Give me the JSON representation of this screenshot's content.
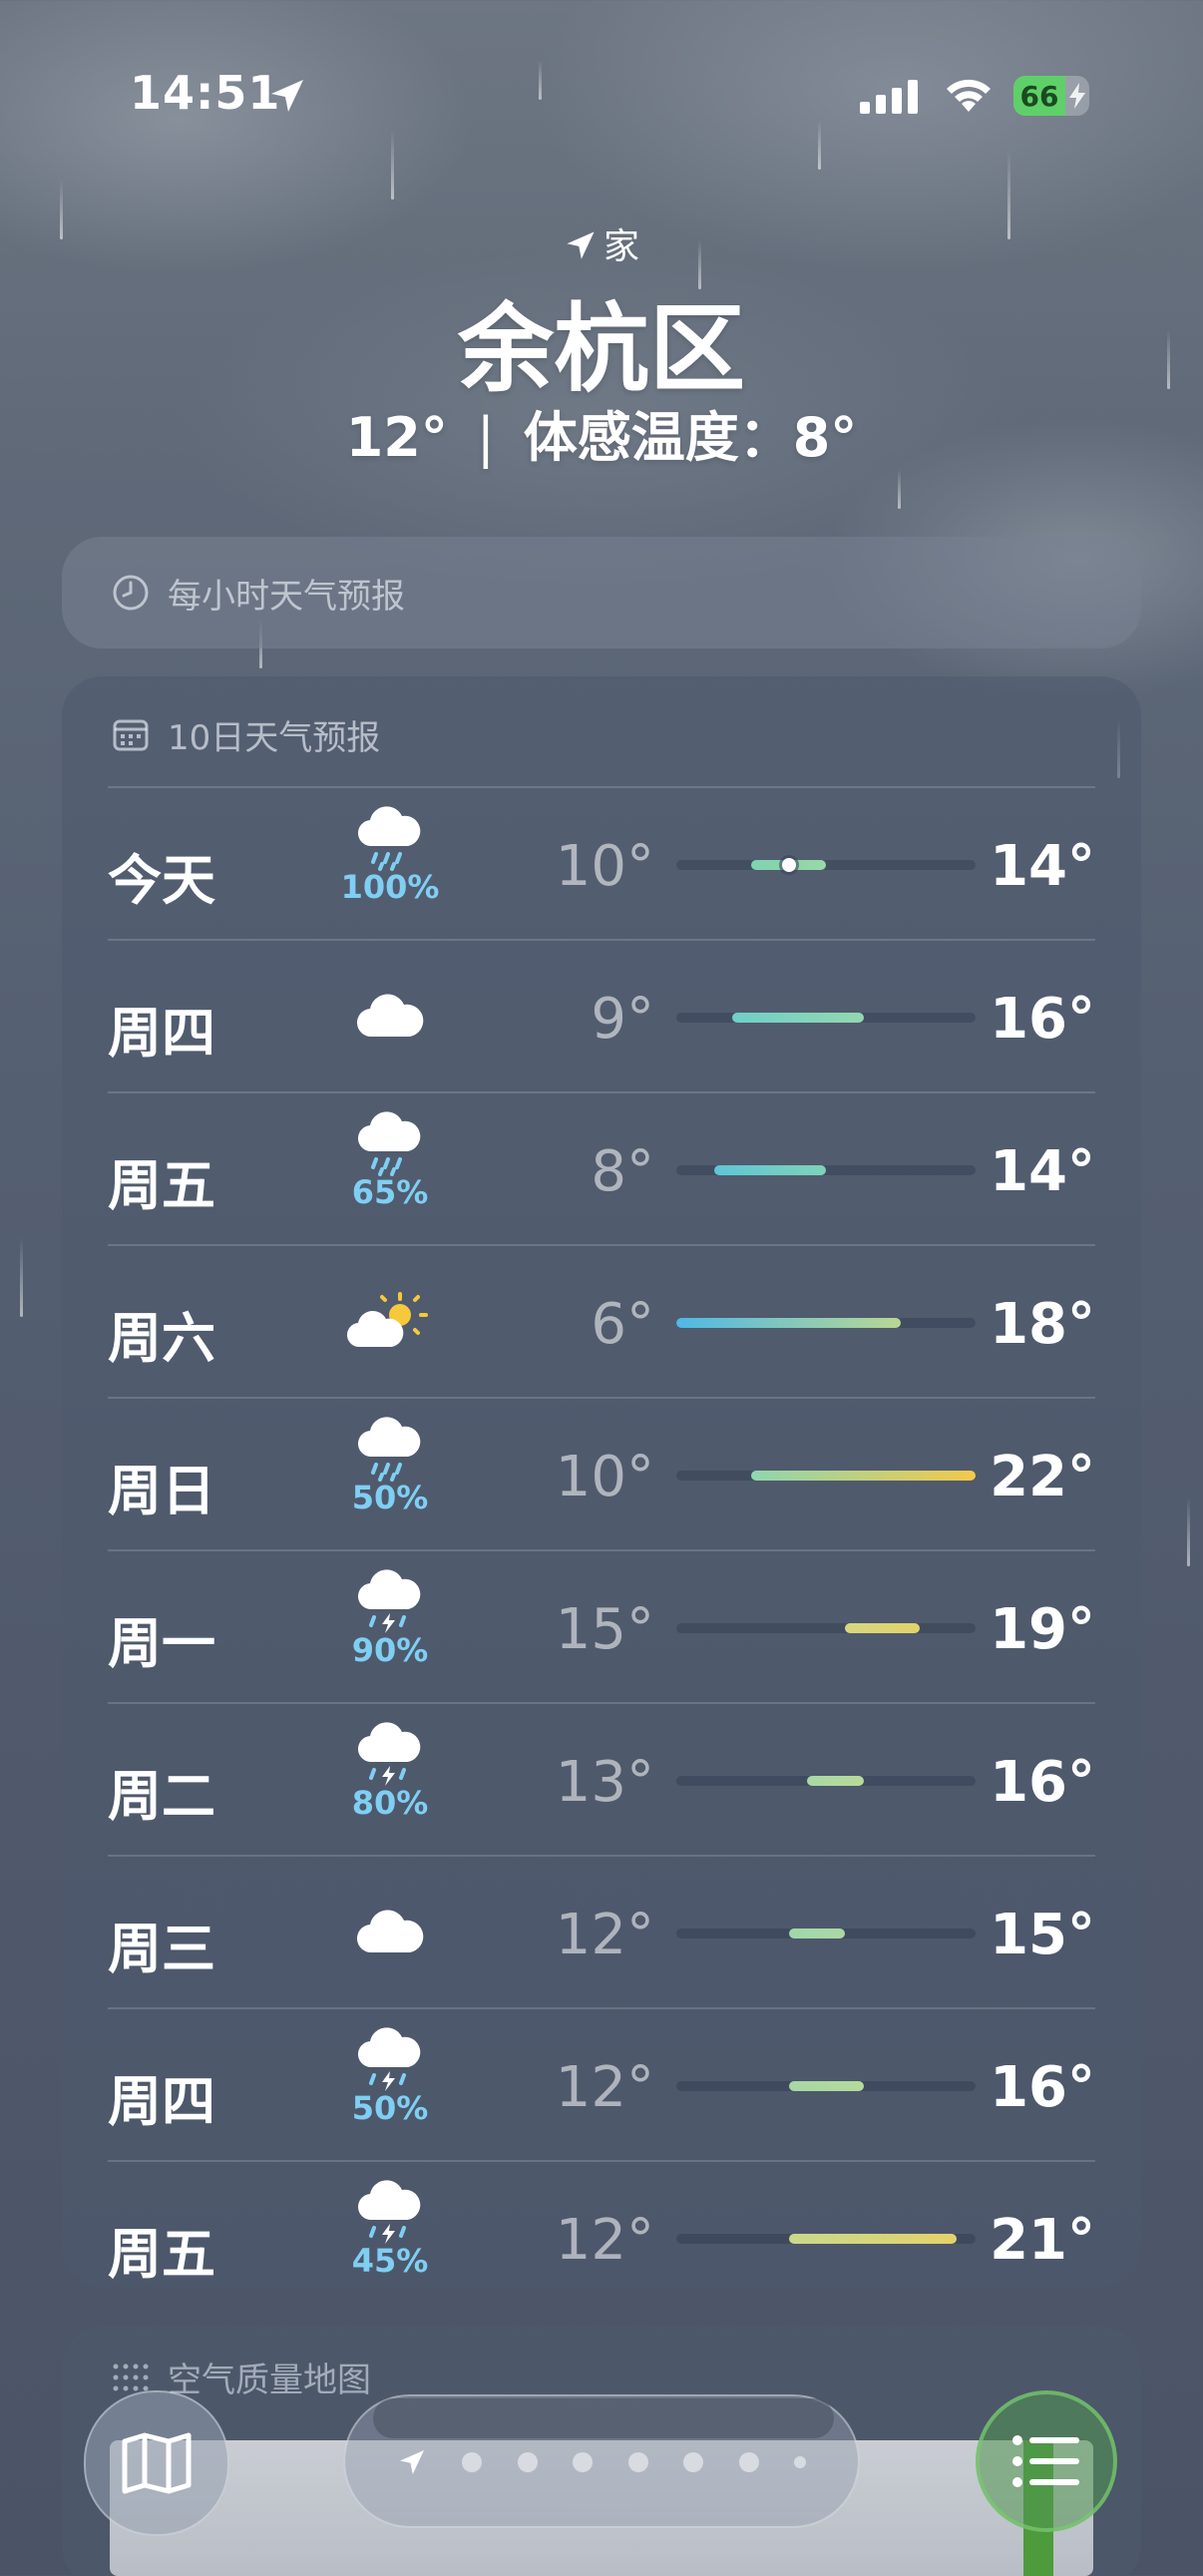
{
  "status_bar": {
    "time": "14:51",
    "battery": "66",
    "location_services_icon": "location-arrow-icon",
    "signal_icon": "cellular-signal-icon",
    "wifi_icon": "wifi-icon"
  },
  "header": {
    "location_label": "家",
    "city": "余杭区",
    "current_temp": "12°",
    "separator": "|",
    "feels_like": "体感温度：8°"
  },
  "hourly_card": {
    "title": "每小时天气预报",
    "icon": "clock-icon"
  },
  "daily_card": {
    "title": "10日天气预报",
    "icon": "calendar-icon",
    "range": [
      6,
      22
    ],
    "days": [
      {
        "day": "今天",
        "icon": "rain-icon",
        "precip": "100%",
        "low": "10°",
        "high": "14°",
        "lo": 10,
        "hi": 14,
        "current": 12,
        "colors": [
          "#7ed2b0",
          "#9ad8a8"
        ]
      },
      {
        "day": "周四",
        "icon": "cloud-icon",
        "precip": "",
        "low": "9°",
        "high": "16°",
        "lo": 9,
        "hi": 16,
        "colors": [
          "#6fcfc8",
          "#93d7b0"
        ]
      },
      {
        "day": "周五",
        "icon": "rain-icon",
        "precip": "65%",
        "low": "8°",
        "high": "14°",
        "lo": 8,
        "hi": 14,
        "colors": [
          "#5fc6d6",
          "#7ed2b8"
        ]
      },
      {
        "day": "周六",
        "icon": "partly-sunny-icon",
        "precip": "",
        "low": "6°",
        "high": "18°",
        "lo": 6,
        "hi": 18,
        "colors": [
          "#4eb8e6",
          "#b8d892"
        ]
      },
      {
        "day": "周日",
        "icon": "rain-icon",
        "precip": "50%",
        "low": "10°",
        "high": "22°",
        "lo": 10,
        "hi": 22,
        "colors": [
          "#8fd6b0",
          "#f2c94c"
        ]
      },
      {
        "day": "周一",
        "icon": "thunderstorm-icon",
        "precip": "90%",
        "low": "15°",
        "high": "19°",
        "lo": 15,
        "hi": 19,
        "colors": [
          "#d8d780",
          "#e2d26a"
        ]
      },
      {
        "day": "周二",
        "icon": "thunderstorm-icon",
        "precip": "80%",
        "low": "13°",
        "high": "16°",
        "lo": 13,
        "hi": 16,
        "colors": [
          "#a8d9a6",
          "#b7da98"
        ]
      },
      {
        "day": "周三",
        "icon": "cloud-icon",
        "precip": "",
        "low": "12°",
        "high": "15°",
        "lo": 12,
        "hi": 15,
        "colors": [
          "#9fd8aa",
          "#abd8a2"
        ]
      },
      {
        "day": "周四",
        "icon": "thunderstorm-icon",
        "precip": "50%",
        "low": "12°",
        "high": "16°",
        "lo": 12,
        "hi": 16,
        "colors": [
          "#a6d8a6",
          "#b4da9a"
        ]
      },
      {
        "day": "周五",
        "icon": "thunderstorm-icon",
        "precip": "45%",
        "low": "12°",
        "high": "21°",
        "lo": 12,
        "hi": 21,
        "colors": [
          "#c9d98c",
          "#e4d26a"
        ]
      }
    ]
  },
  "air_quality_card": {
    "title": "空气质量地图",
    "icon": "grid-dots-icon"
  },
  "bottom_bar": {
    "map_button_icon": "map-icon",
    "list_button_icon": "list-icon",
    "pages": 8
  }
}
